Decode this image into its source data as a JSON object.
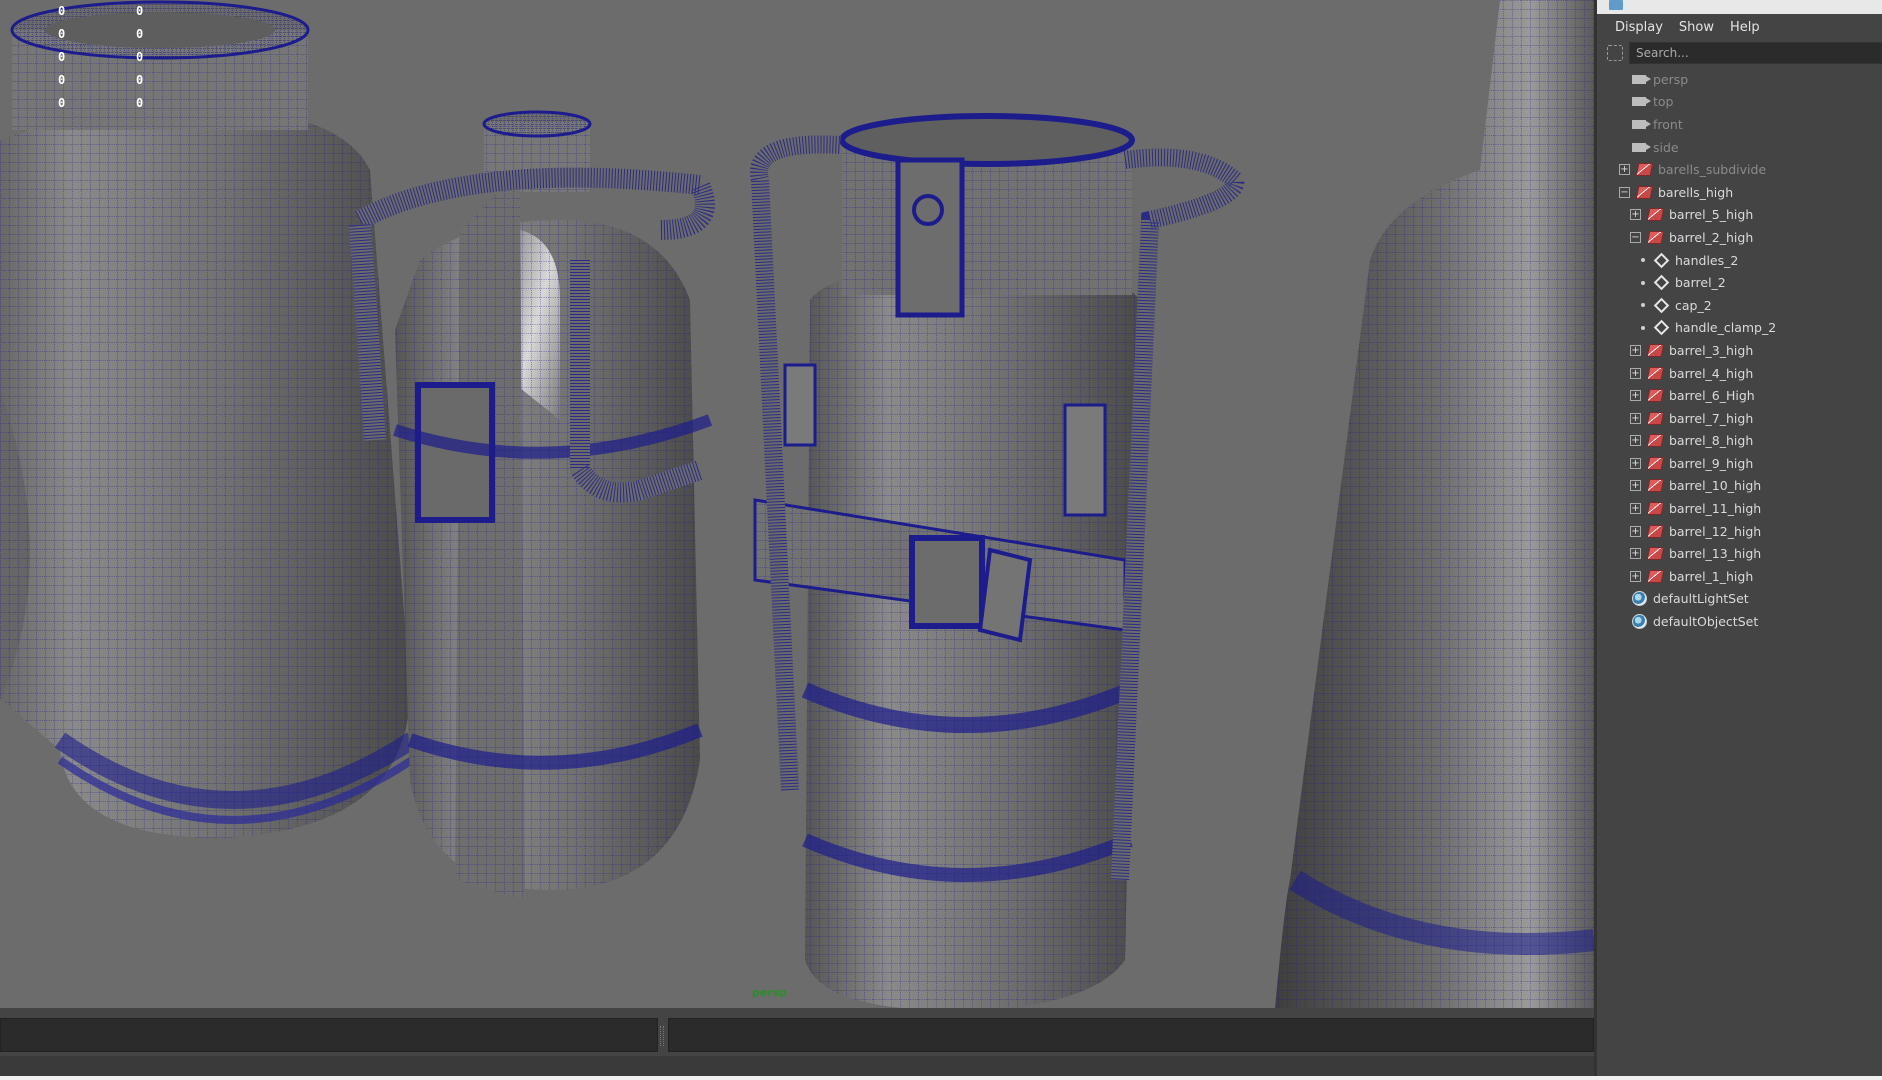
{
  "viewport": {
    "camera_label": "persp",
    "hud_rows": [
      [
        "0",
        "0"
      ],
      [
        "0",
        "0"
      ],
      [
        "0",
        "0"
      ],
      [
        "0",
        "0"
      ],
      [
        "0",
        "0"
      ]
    ]
  },
  "outliner": {
    "menus": [
      "Display",
      "Show",
      "Help"
    ],
    "search_placeholder": "Search...",
    "items": [
      {
        "label": "persp",
        "type": "camera",
        "depth": 0,
        "dim": true
      },
      {
        "label": "top",
        "type": "camera",
        "depth": 0,
        "dim": true
      },
      {
        "label": "front",
        "type": "camera",
        "depth": 0,
        "dim": true
      },
      {
        "label": "side",
        "type": "camera",
        "depth": 0,
        "dim": true
      },
      {
        "label": "barells_subdivide",
        "type": "group",
        "depth": 0,
        "dim": true,
        "expander": "+"
      },
      {
        "label": "barells_high",
        "type": "group",
        "depth": 0,
        "expander": "-"
      },
      {
        "label": "barrel_5_high",
        "type": "group",
        "depth": 1,
        "expander": "+"
      },
      {
        "label": "barrel_2_high",
        "type": "group",
        "depth": 1,
        "expander": "-"
      },
      {
        "label": "handles_2",
        "type": "mesh",
        "depth": 2
      },
      {
        "label": "barrel_2",
        "type": "mesh",
        "depth": 2
      },
      {
        "label": "cap_2",
        "type": "mesh",
        "depth": 2
      },
      {
        "label": "handle_clamp_2",
        "type": "mesh",
        "depth": 2
      },
      {
        "label": "barrel_3_high",
        "type": "group",
        "depth": 1,
        "expander": "+"
      },
      {
        "label": "barrel_4_high",
        "type": "group",
        "depth": 1,
        "expander": "+"
      },
      {
        "label": "barrel_6_High",
        "type": "group",
        "depth": 1,
        "expander": "+"
      },
      {
        "label": "barrel_7_high",
        "type": "group",
        "depth": 1,
        "expander": "+"
      },
      {
        "label": "barrel_8_high",
        "type": "group",
        "depth": 1,
        "expander": "+"
      },
      {
        "label": "barrel_9_high",
        "type": "group",
        "depth": 1,
        "expander": "+"
      },
      {
        "label": "barrel_10_high",
        "type": "group",
        "depth": 1,
        "expander": "+"
      },
      {
        "label": "barrel_11_high",
        "type": "group",
        "depth": 1,
        "expander": "+"
      },
      {
        "label": "barrel_12_high",
        "type": "group",
        "depth": 1,
        "expander": "+"
      },
      {
        "label": "barrel_13_high",
        "type": "group",
        "depth": 1,
        "expander": "+"
      },
      {
        "label": "barrel_1_high",
        "type": "group",
        "depth": 1,
        "expander": "+"
      },
      {
        "label": "defaultLightSet",
        "type": "set",
        "depth": 0
      },
      {
        "label": "defaultObjectSet",
        "type": "set",
        "depth": 0
      }
    ]
  },
  "colors": {
    "viewport_bg": "#6c6c6c",
    "wireframe": "#1c1c8c",
    "camera_label": "#2e8b2e",
    "panel_bg": "#444444"
  },
  "icons": {
    "camera": "camera-icon",
    "group": "group-icon",
    "mesh": "mesh-icon",
    "set": "set-icon"
  }
}
